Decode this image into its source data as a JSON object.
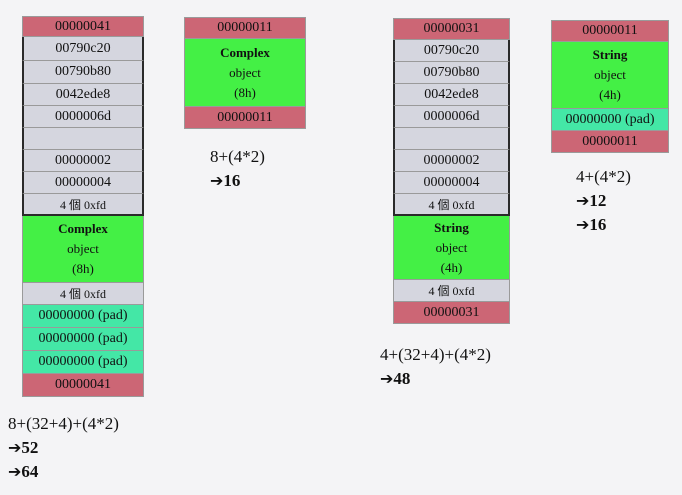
{
  "complex_layout_debug": {
    "header": "00000041",
    "debug_words": [
      "00790c20",
      "00790b80",
      "0042ede8",
      "0000006d",
      "",
      "00000002",
      "00000004"
    ],
    "guard_front": "4 個 0xfd",
    "object_title": "Complex",
    "object_word": "object",
    "object_size": "(8h)",
    "guard_back": "4 個 0xfd",
    "pads": [
      "00000000 (pad)",
      "00000000 (pad)",
      "00000000 (pad)"
    ],
    "footer": "00000041",
    "calc": {
      "formula": "8+(32+4)+(4*2)",
      "results": [
        "52",
        "64"
      ]
    }
  },
  "complex_layout_release": {
    "header": "00000011",
    "object_title": "Complex",
    "object_word": "object",
    "object_size": "(8h)",
    "footer": "00000011",
    "calc": {
      "formula": "8+(4*2)",
      "results": [
        "16"
      ]
    }
  },
  "string_layout_debug": {
    "header": "00000031",
    "debug_words": [
      "00790c20",
      "00790b80",
      "0042ede8",
      "0000006d",
      "",
      "00000002",
      "00000004"
    ],
    "guard_front": "4 個 0xfd",
    "object_title": "String",
    "object_word": "object",
    "object_size": "(4h)",
    "guard_back": "4 個 0xfd",
    "footer": "00000031",
    "calc": {
      "formula": "4+(32+4)+(4*2)",
      "results": [
        "48"
      ]
    }
  },
  "string_layout_release": {
    "header": "00000011",
    "object_title": "String",
    "object_word": "object",
    "object_size": "(4h)",
    "pad": "00000000 (pad)",
    "footer": "00000011",
    "calc": {
      "formula": "4+(4*2)",
      "results": [
        "12",
        "16"
      ]
    }
  },
  "arrow_glyph": "➔",
  "colors": {
    "cookie": "#cc6675",
    "debug": "#d5d6df",
    "object": "#44f045",
    "pad": "#44e7a6"
  }
}
